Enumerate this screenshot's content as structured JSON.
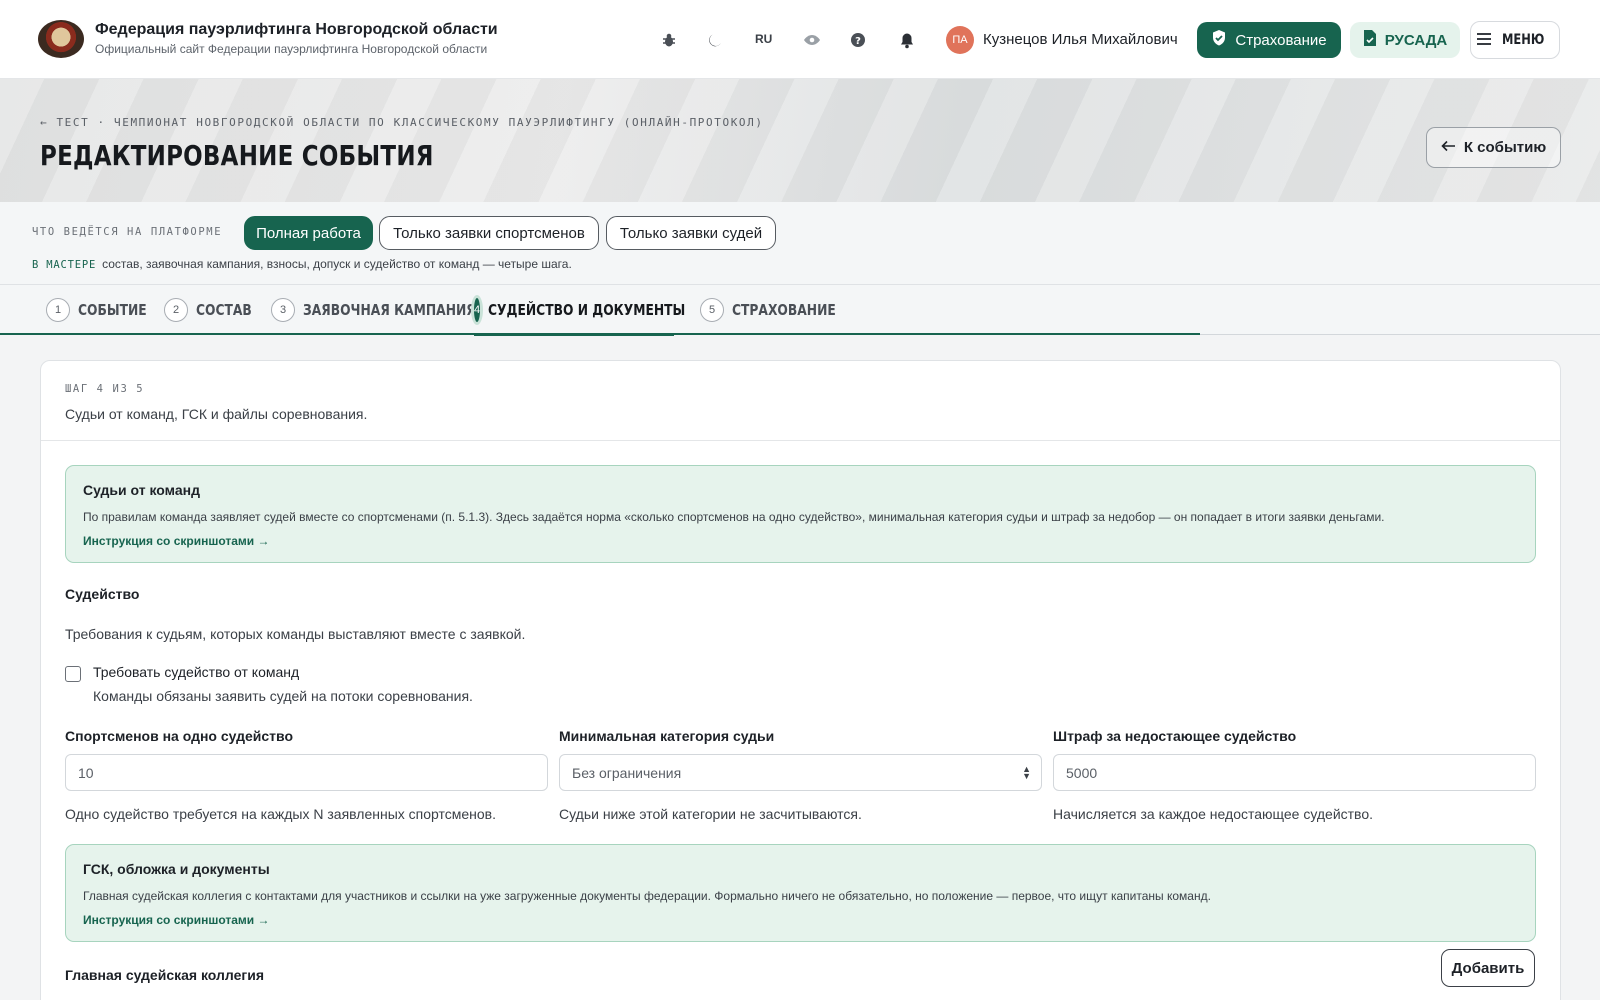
{
  "header": {
    "site_title": "Федерация пауэрлифтинга Новгородской области",
    "site_subtitle": "Официальный сайт Федерации пауэрлифтинга Новгородской области",
    "lang": "RU",
    "user_initials": "ПА",
    "user_name": "Кузнецов Илья Михайлович",
    "insurance_button": "Страхование",
    "rusada_button": "РУСАДА",
    "menu_button": "МЕНЮ"
  },
  "hero": {
    "breadcrumb": "← ТЕСТ · ЧЕМПИОНАТ НОВГОРОДСКОЙ ОБЛАСТИ ПО КЛАССИЧЕСКОМУ ПАУЭРЛИФТИНГУ (ОНЛАЙН-ПРОТОКОЛ)",
    "title": "РЕДАКТИРОВАНИЕ СОБЫТИЯ",
    "back_button": "К событию"
  },
  "mode": {
    "label": "ЧТО ВЕДЁТСЯ НА ПЛАТФОРМЕ",
    "options": [
      "Полная работа",
      "Только заявки спортсменов",
      "Только заявки судей"
    ],
    "selected": "Полная работа",
    "note_tag": "В МАСТЕРЕ",
    "note": "состав, заявочная кампания, взносы, допуск и судейство от команд — четыре шага."
  },
  "steps": [
    {
      "num": "1",
      "label": "СОБЫТИЕ"
    },
    {
      "num": "2",
      "label": "СОСТАВ"
    },
    {
      "num": "3",
      "label": "ЗАЯВОЧНАЯ КАМПАНИЯ"
    },
    {
      "num": "4",
      "label": "СУДЕЙСТВО И ДОКУМЕНТЫ"
    },
    {
      "num": "5",
      "label": "СТРАХОВАНИЕ"
    }
  ],
  "active_step": "4",
  "card": {
    "step_of": "ШАГ 4 ИЗ 5",
    "description": "Судьи от команд, ГСК и файлы соревнования.",
    "info1": {
      "title": "Судьи от команд",
      "text": "По правилам команда заявляет судей вместе со спортсменами (п. 5.1.3). Здесь задаётся норма «сколько спортсменов на одно судейство», минимальная категория судьи и штраф за недобор — он попадает в итоги заявки деньгами.",
      "link": "Инструкция со скриншотами →"
    },
    "judging": {
      "title": "Судейство",
      "description": "Требования к судьям, которых команды выставляют вместе с заявкой.",
      "checkbox_label": "Требовать судейство от команд",
      "checkbox_checked": false,
      "checkbox_help": "Команды обязаны заявить судей на потоки соревнования."
    },
    "fields": [
      {
        "label": "Спортсменов на одно судейство",
        "value": "10",
        "help": "Одно судейство требуется на каждых N заявленных спортсменов."
      },
      {
        "label": "Минимальная категория судьи",
        "value": "Без ограничения",
        "help": "Судьи ниже этой категории не засчитываются."
      },
      {
        "label": "Штраф за недостающее судейство",
        "value": "5000",
        "help": "Начисляется за каждое недостающее судейство."
      }
    ],
    "info2": {
      "title": "ГСК, обложка и документы",
      "text": "Главная судейская коллегия с контактами для участников и ссылки на уже загруженные документы федерации. Формально ничего не обязательно, но положение — первое, что ищут капитаны команд.",
      "link": "Инструкция со скриншотами →"
    },
    "gsk_title": "Главная судейская коллегия",
    "add_button": "Добавить"
  },
  "icons": [
    "bug-icon",
    "moon-icon",
    "eye-icon",
    "help-icon",
    "bell-icon",
    "shield-icon",
    "file-icon",
    "hamburger-icon",
    "arrow-left-icon"
  ],
  "colors": {
    "accent": "#17644f",
    "accent_soft": "#e6f3ec",
    "avatar": "#e0735a"
  }
}
